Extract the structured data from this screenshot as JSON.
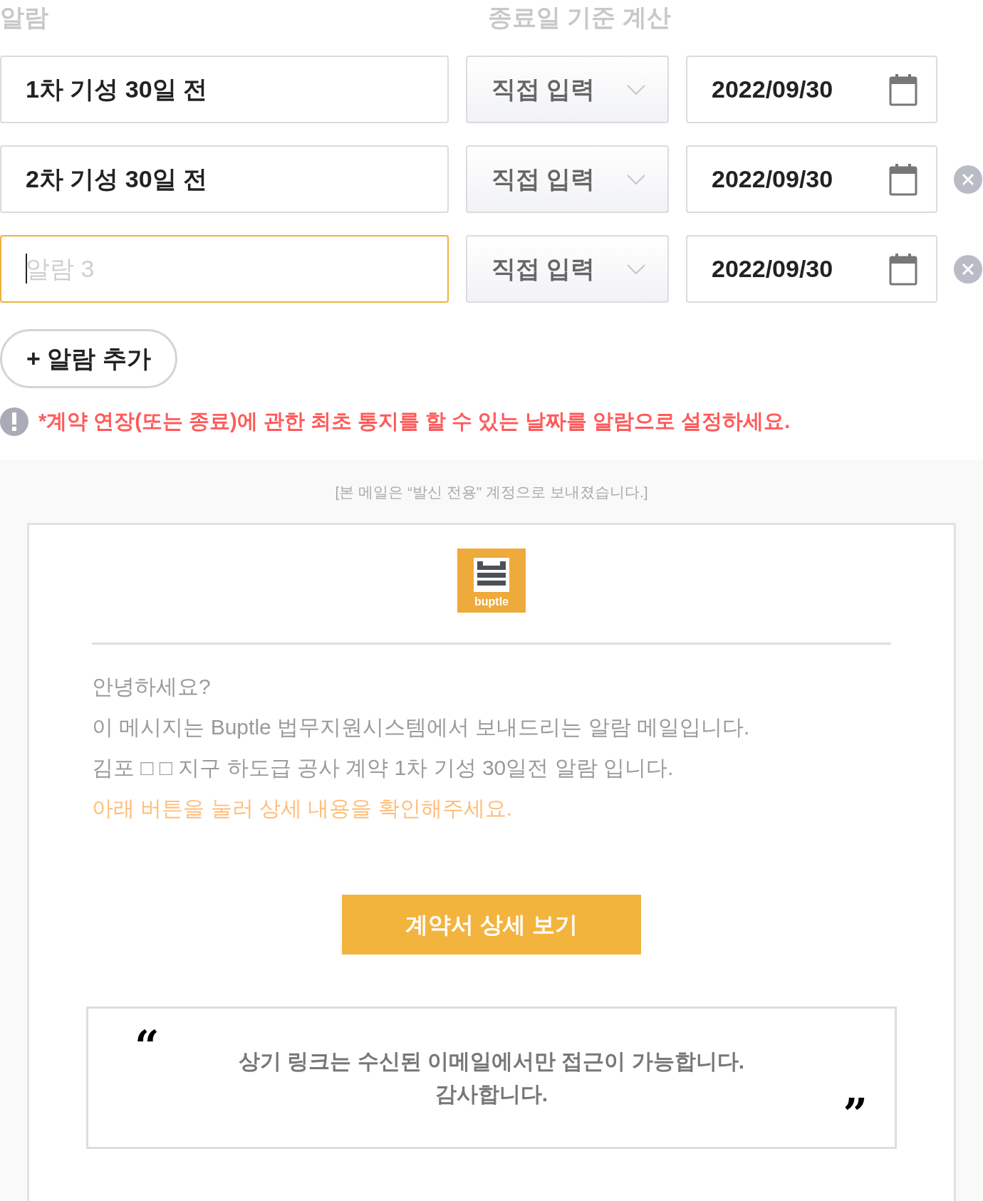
{
  "headers": {
    "alarm": "알람",
    "calc": "종료일 기준 계산"
  },
  "alarms": [
    {
      "value": "1차 기성 30일 전",
      "focused": false,
      "method": "직접 입력",
      "date": "2022/09/30",
      "removable": false
    },
    {
      "value": "2차 기성 30일 전",
      "focused": false,
      "method": "직접 입력",
      "date": "2022/09/30",
      "removable": true
    },
    {
      "placeholder": "알람 3",
      "focused": true,
      "method": "직접 입력",
      "date": "2022/09/30",
      "removable": true
    }
  ],
  "add_button": "+ 알람 추가",
  "warning": "*계약 연장(또는 종료)에 관한 최초 통지를 할 수 있는 날짜를 알람으로 설정하세요.",
  "email": {
    "notice": "[본 메일은 “발신 전용\" 계정으로 보내졌습니다.]",
    "logo_text": "buptle",
    "lines": [
      {
        "text": "안녕하세요?",
        "kind": "plain"
      },
      {
        "text": "이 메시지는 Buptle 법무지원시스템에서 보내드리는 알람 메일입니다.",
        "kind": "plain"
      },
      {
        "text": "김포 □ □ 지구 하도급 공사 계약 1차 기성 30일전 알람 입니다.",
        "kind": "plain"
      },
      {
        "text": "아래 버튼을 눌러 상세 내용을 확인해주세요.",
        "kind": "highlight"
      }
    ],
    "button": "계약서 상세 보기",
    "quote_open": "“",
    "quote_lines": [
      "상기 링크는 수신된 이메일에서만 접근이 가능합니다.",
      "감사합니다."
    ],
    "quote_close": "”"
  }
}
